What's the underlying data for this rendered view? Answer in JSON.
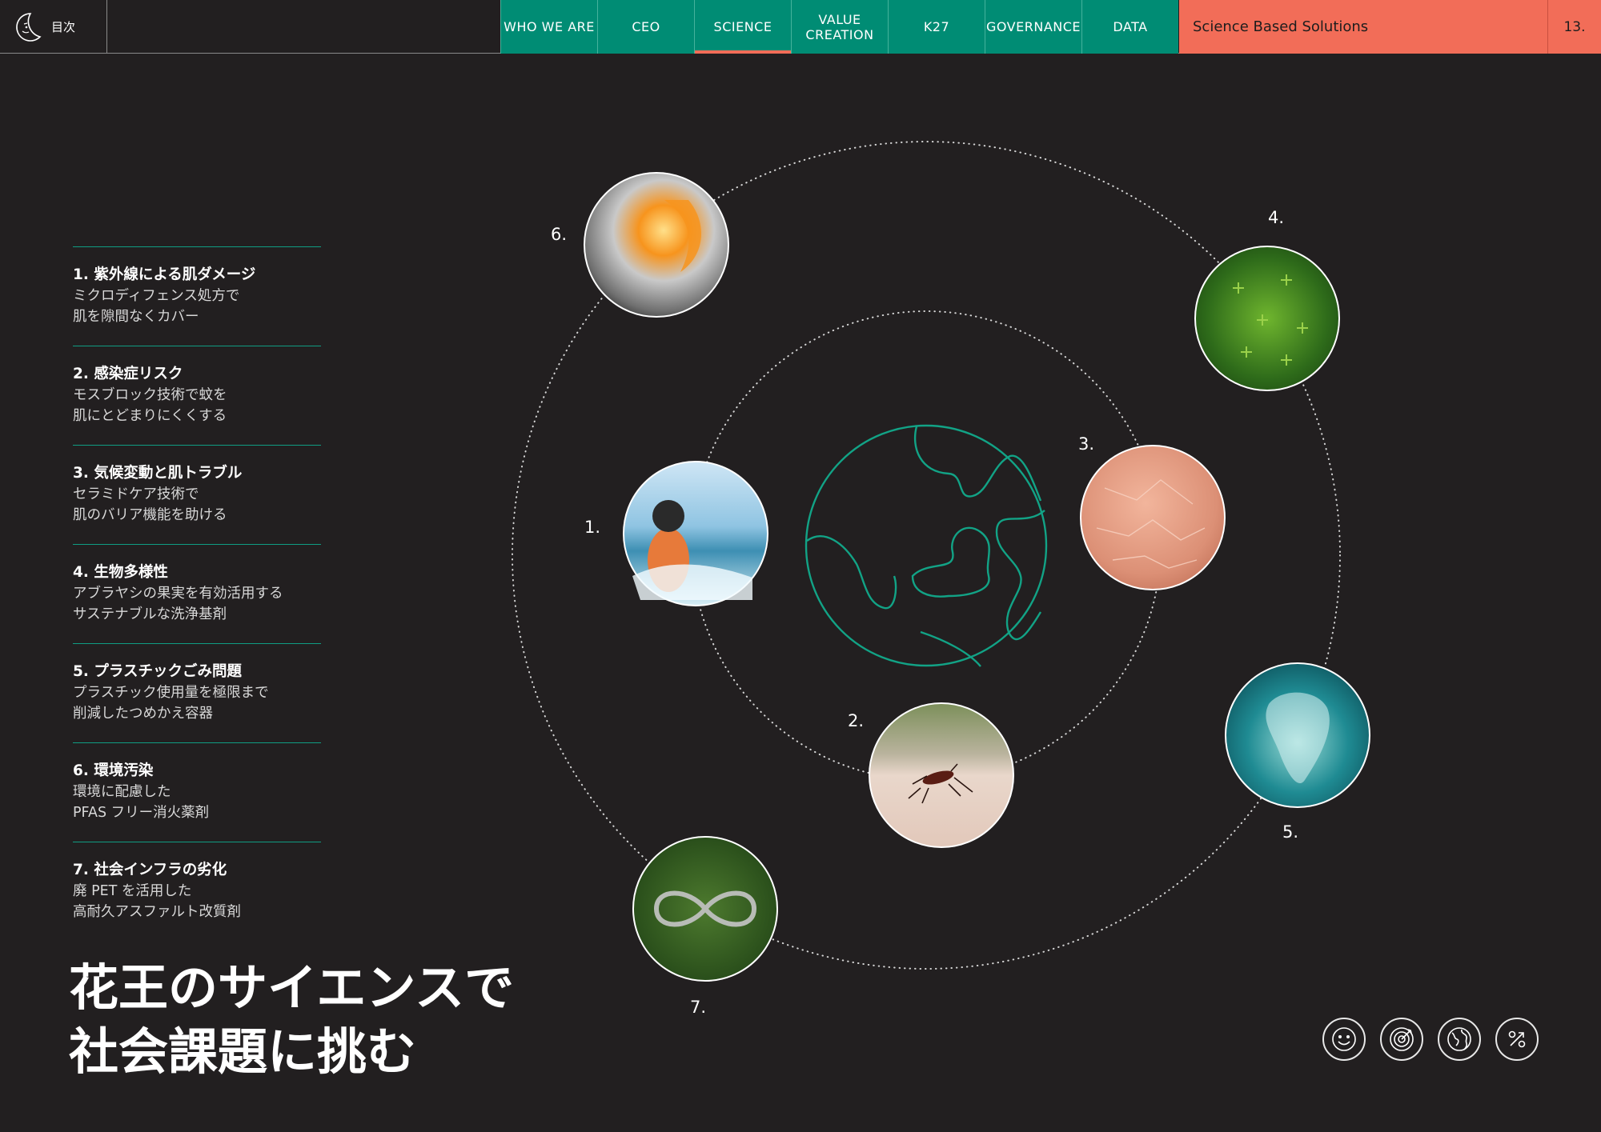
{
  "header": {
    "toc_label": "目次",
    "nav": [
      {
        "label": "WHO WE ARE",
        "active": false
      },
      {
        "label": "CEO",
        "active": false
      },
      {
        "label": "SCIENCE",
        "active": true
      },
      {
        "label": "VALUE\nCREATION",
        "active": false
      },
      {
        "label": "K27",
        "active": false
      },
      {
        "label": "GOVERNANCE",
        "active": false
      },
      {
        "label": "DATA",
        "active": false
      }
    ],
    "section_title": "Science Based Solutions",
    "page_number": "13."
  },
  "issues": [
    {
      "title": "1. 紫外線による肌ダメージ",
      "desc": "ミクロディフェンス処方で\n肌を隙間なくカバー"
    },
    {
      "title": "2. 感染症リスク",
      "desc": "モスブロック技術で蚊を\n肌にとどまりにくくする"
    },
    {
      "title": "3. 気候変動と肌トラブル",
      "desc": "セラミドケア技術で\n肌のバリア機能を助ける"
    },
    {
      "title": "4. 生物多様性",
      "desc": "アブラヤシの果実を有効活用する\nサステナブルな洗浄基剤"
    },
    {
      "title": "5. プラスチックごみ問題",
      "desc": "プラスチック使用量を極限まで\n削減したつめかえ容器"
    },
    {
      "title": "6. 環境汚染",
      "desc": "環境に配慮した\nPFAS フリー消火薬剤"
    },
    {
      "title": "7. 社会インフラの劣化",
      "desc": "廃 PET を活用した\n高耐久アスファルト改質剤"
    }
  ],
  "headline": "花王のサイエンスで\n社会課題に挑む",
  "diagram": {
    "labels": [
      "1.",
      "2.",
      "3.",
      "4.",
      "5.",
      "6.",
      "7."
    ],
    "photos": [
      "child-at-beach",
      "mosquito-on-skin",
      "dry-skin-closeup",
      "oil-palm-forest",
      "plastic-bag-in-ocean",
      "fire-and-foam",
      "infinity-road"
    ]
  },
  "bottom_icons": [
    "smile-icon",
    "target-icon",
    "globe-icon",
    "growth-percent-icon"
  ],
  "colors": {
    "background": "#221f20",
    "teal": "#008c74",
    "accent": "#f26d58",
    "line": "#0f9d83"
  }
}
